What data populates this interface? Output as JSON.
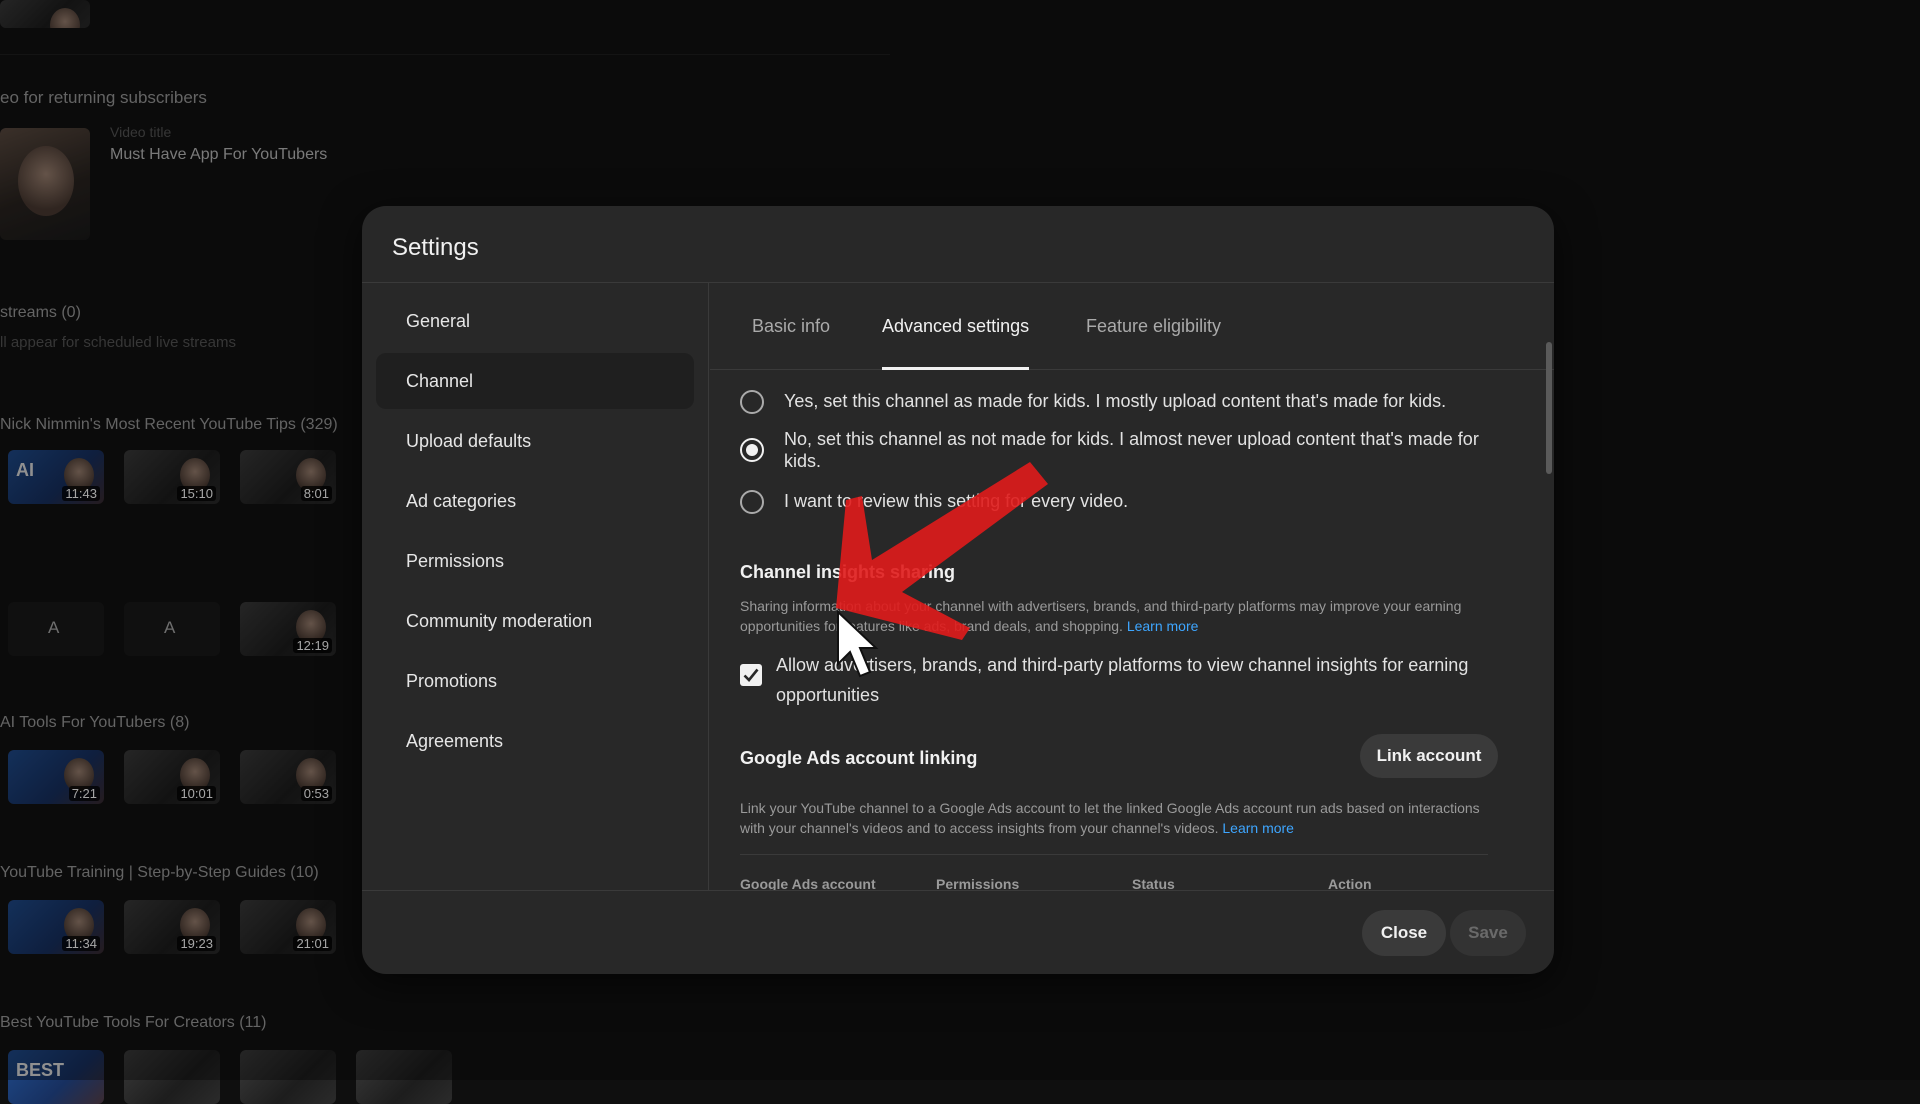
{
  "background": {
    "sections": [
      {
        "heading": "eo for returning subscribers"
      },
      {
        "heading": "streams (0)",
        "sub": "ll appear for scheduled live streams"
      },
      {
        "heading": "Nick Nimmin's Most Recent YouTube Tips (329)"
      },
      {
        "heading": "AI Tools For YouTubers (8)"
      },
      {
        "heading": "YouTube Training | Step-by-Step Guides (10)"
      },
      {
        "heading": "Best YouTube Tools For Creators (11)"
      }
    ],
    "featured_card": {
      "label": "Video title",
      "title": "Must Have App For YouTubers"
    },
    "thumbs_row1": [
      {
        "tag": "AI",
        "duration": "11:43"
      },
      {
        "tag": "",
        "duration": "15:10"
      },
      {
        "tag": "",
        "duration": "8:01"
      }
    ],
    "thumbs_row2": [
      {
        "tag": "A",
        "duration": ""
      },
      {
        "tag": "A",
        "duration": ""
      },
      {
        "tag": "",
        "duration": "12:19"
      }
    ],
    "thumbs_row3": [
      {
        "tag": "",
        "duration": "7:21"
      },
      {
        "tag": "",
        "duration": "10:01"
      },
      {
        "tag": "",
        "duration": "0:53"
      }
    ],
    "thumbs_row4": [
      {
        "tag": "",
        "duration": "11:34"
      },
      {
        "tag": "",
        "duration": "19:23"
      },
      {
        "tag": "",
        "duration": "21:01"
      }
    ],
    "thumbs_row5": [
      {
        "tag": "BEST",
        "duration": ""
      }
    ]
  },
  "dialog": {
    "title": "Settings",
    "nav": [
      {
        "label": "General"
      },
      {
        "label": "Channel"
      },
      {
        "label": "Upload defaults"
      },
      {
        "label": "Ad categories"
      },
      {
        "label": "Permissions"
      },
      {
        "label": "Community moderation"
      },
      {
        "label": "Promotions"
      },
      {
        "label": "Agreements"
      }
    ],
    "active_nav": "Channel",
    "tabs": [
      {
        "label": "Basic info"
      },
      {
        "label": "Advanced settings"
      },
      {
        "label": "Feature eligibility"
      }
    ],
    "active_tab": "Advanced settings",
    "audience_options": [
      {
        "label": "Yes, set this channel as made for kids. I mostly upload content that's made for kids.",
        "selected": false
      },
      {
        "label": "No, set this channel as not made for kids. I almost never upload content that's made for kids.",
        "selected": true
      },
      {
        "label": "I want to review this setting for every video.",
        "selected": false
      }
    ],
    "insights": {
      "title": "Channel insights sharing",
      "description": "Sharing information about your channel with advertisers, brands, and third-party platforms may improve your earning opportunities for features like ads, brand deals, and shopping.",
      "learn_more": "Learn more",
      "checkbox_label": "Allow advertisers, brands, and third-party platforms to view channel insights for earning opportunities",
      "checked": true
    },
    "ads_linking": {
      "title": "Google Ads account linking",
      "button": "Link account",
      "description": "Link your YouTube channel to a Google Ads account to let the linked Google Ads account run ads based on interactions with your channel's videos and to access insights from your channel's videos.",
      "learn_more": "Learn more",
      "columns": [
        "Google Ads account",
        "Permissions",
        "Status",
        "Action"
      ]
    },
    "footer": {
      "close": "Close",
      "save": "Save"
    }
  },
  "colors": {
    "dialog_bg": "#282828",
    "page_bg": "#0f0f0f",
    "link": "#3ea6ff",
    "annotation_arrow": "#e01b1b"
  }
}
